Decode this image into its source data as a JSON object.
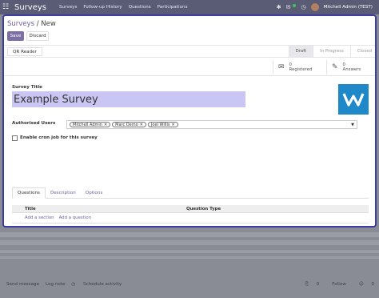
{
  "navbar": {
    "app_name": "Surveys",
    "menu": [
      "Surveys",
      "Follow-up History",
      "Questions",
      "Participations"
    ],
    "user": "Mitchell Admin (TEST)"
  },
  "breadcrumb": {
    "parent": "Surveys",
    "sep": "/",
    "current": "New"
  },
  "actions": {
    "save": "Save",
    "discard": "Discard"
  },
  "header": {
    "qr_button": "QR Reader"
  },
  "stages": [
    "Draft",
    "In Progress",
    "Closed"
  ],
  "active_stage": "Draft",
  "smart_buttons": [
    {
      "count": "0",
      "label": "Registered",
      "icon": "envelope-icon"
    },
    {
      "count": "0",
      "label": "Answers",
      "icon": "pencil-square-icon"
    }
  ],
  "form": {
    "title_label": "Survey Title",
    "title_value": "Example Survey",
    "users_label": "Authorised Users",
    "users": [
      "Mitchell Admin",
      "Marc Demo",
      "Joel Willis"
    ],
    "cron_label": "Enable cron job for this survey"
  },
  "tabs": [
    "Questions",
    "Description",
    "Options"
  ],
  "table": {
    "columns": [
      "Title",
      "Question Type"
    ],
    "add_section": "Add a section",
    "add_question": "Add a question"
  },
  "chatter": {
    "send": "Send message",
    "log": "Log note",
    "schedule": "Schedule activity",
    "followers": "0",
    "follow": "Follow",
    "followers_count": "0"
  },
  "colors": {
    "navbar": "#5a5c75",
    "primary": "#7c6fa6",
    "modal_border": "#3c3da3",
    "title_highlight": "#c9c6f3",
    "logo_bg": "#1e88c8"
  }
}
